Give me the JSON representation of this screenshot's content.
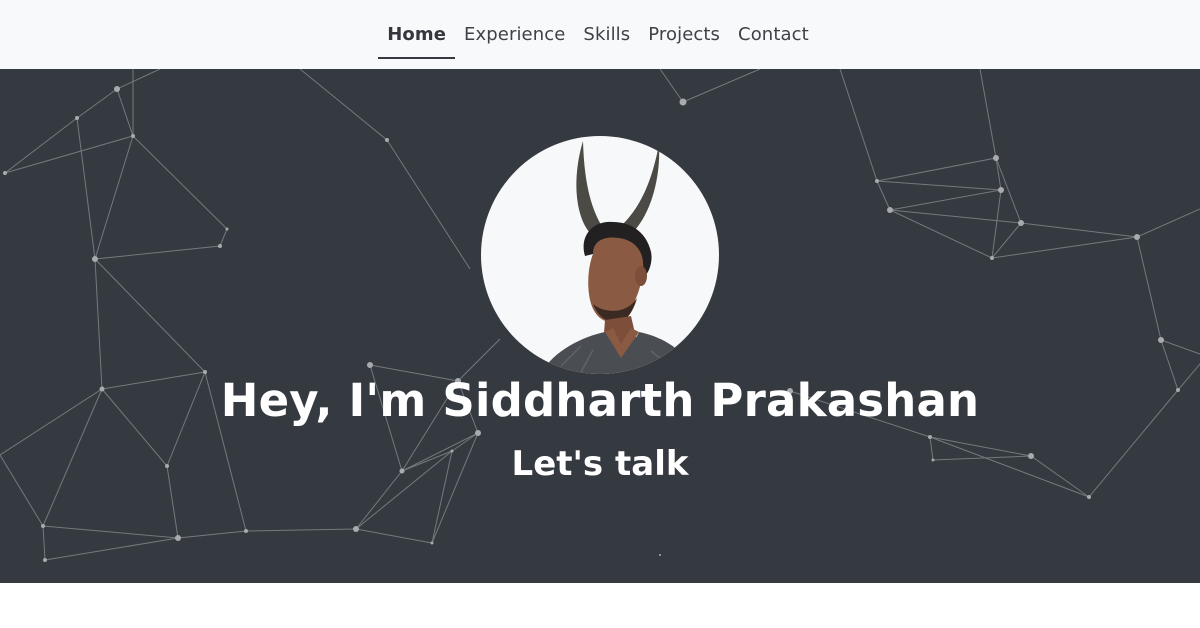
{
  "nav": {
    "items": [
      {
        "label": "Home",
        "active": true
      },
      {
        "label": "Experience",
        "active": false
      },
      {
        "label": "Skills",
        "active": false
      },
      {
        "label": "Projects",
        "active": false
      },
      {
        "label": "Contact",
        "active": false
      }
    ]
  },
  "hero": {
    "title": "Hey, I'm Siddharth Prakashan",
    "subtitle": "Let's talk",
    "avatar_icon": "profile-photo"
  },
  "colors": {
    "navbar_bg": "#f8f9fa",
    "hero_bg": "#343a40",
    "network_lines": "#8a8e92",
    "text_light": "#ffffff"
  }
}
